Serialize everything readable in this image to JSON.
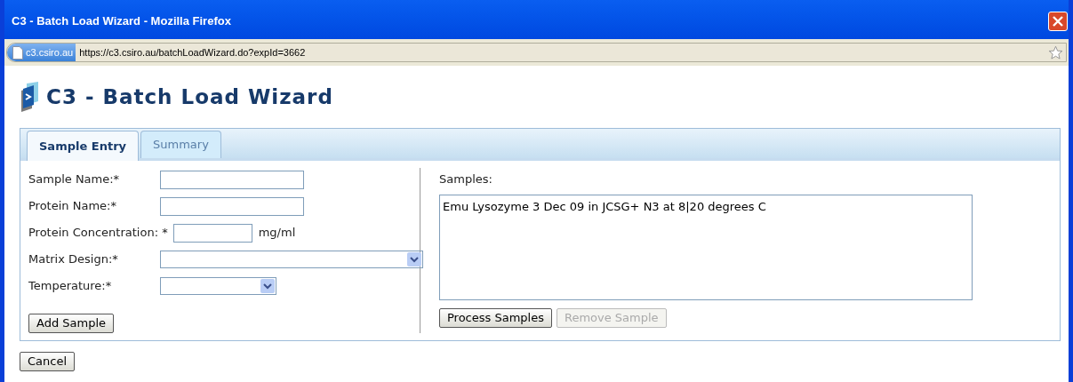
{
  "window": {
    "title": "C3 - Batch Load Wizard - Mozilla Firefox"
  },
  "address_bar": {
    "site_badge": "c3.csiro.au",
    "url": "https://c3.csiro.au/batchLoadWizard.do?expId=3662"
  },
  "page": {
    "heading": "C3 - Batch Load Wizard"
  },
  "tabs": [
    {
      "label": "Sample Entry",
      "selected": true
    },
    {
      "label": "Summary",
      "selected": false
    }
  ],
  "form": {
    "fields": [
      {
        "kind": "text",
        "label": "Sample Name:*"
      },
      {
        "kind": "text",
        "label": "Protein Name:*"
      },
      {
        "kind": "number",
        "label": "Protein Concentration: *",
        "unit": "mg/ml"
      },
      {
        "kind": "wide-select",
        "label": "Matrix Design:*"
      },
      {
        "kind": "select",
        "label": "Temperature:*"
      }
    ],
    "add_button": {
      "label": "Add Sample",
      "disabled": false
    }
  },
  "samples": {
    "label": "Samples:",
    "items": [
      "Emu Lysozyme 3 Dec 09 in JCSG+ N3 at 8|20 degrees C"
    ],
    "buttons": [
      {
        "label": "Process Samples",
        "disabled": false
      },
      {
        "label": "Remove Sample",
        "disabled": true
      }
    ]
  },
  "cancel_button": {
    "label": "Cancel",
    "disabled": false
  }
}
